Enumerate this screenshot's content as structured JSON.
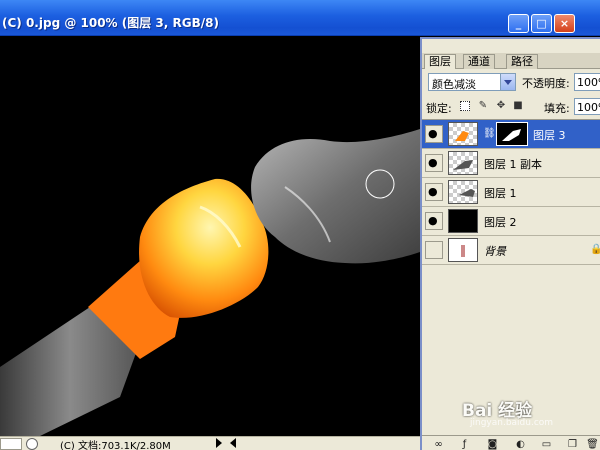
{
  "window": {
    "title": "(C) 0.jpg @ 100% (图层 3, RGB/8)",
    "minimize_label": "_",
    "maximize_label": "□",
    "close_label": "×"
  },
  "statusbar": {
    "doc_size": "(C) 文档:703.1K/2.80M"
  },
  "layers_panel": {
    "tabs": [
      {
        "label": "图层",
        "active": true
      },
      {
        "label": "通道",
        "active": false
      },
      {
        "label": "路径",
        "active": false
      }
    ],
    "blend_mode": "颜色减淡",
    "opacity_label": "不透明度:",
    "opacity_value": "100%",
    "lock_label": "锁定:",
    "fill_label": "填充:",
    "fill_value": "100%",
    "layers": [
      {
        "name": "图层 3",
        "visible": true,
        "selected": true
      },
      {
        "name": "图层 1 副本",
        "visible": true,
        "selected": false
      },
      {
        "name": "图层 1",
        "visible": true,
        "selected": false
      },
      {
        "name": "图层 2",
        "visible": true,
        "selected": false
      },
      {
        "name": "背景",
        "visible": false,
        "selected": false
      }
    ]
  },
  "watermark": {
    "brand": "Bai 经验",
    "url": "jingyan.baidu.com"
  },
  "colors": {
    "titlebar": "#1c5fe0",
    "panel_bg": "#ece9d8",
    "selection": "#3161c8"
  }
}
